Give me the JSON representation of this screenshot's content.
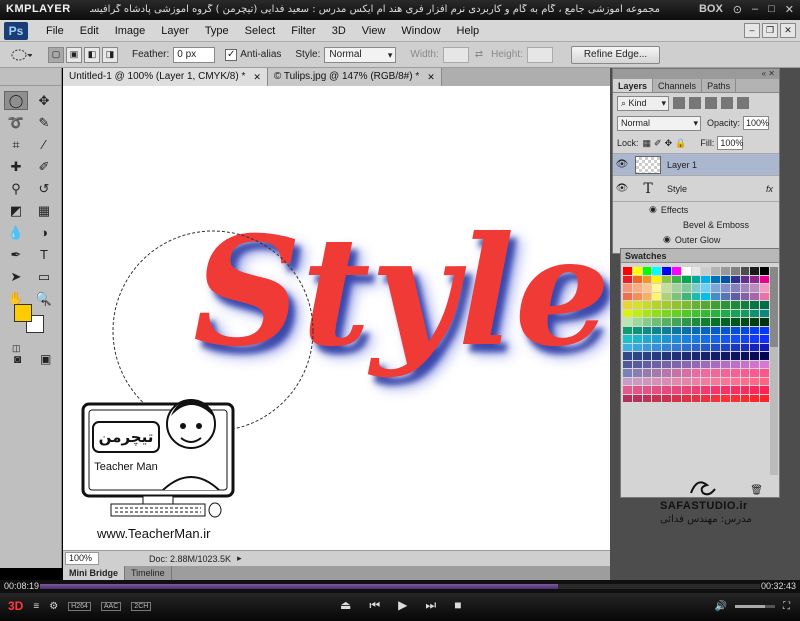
{
  "player": {
    "name": "KMPLAYER",
    "caption": "مجموعه آموزشی جامع ، گام به گام و کاربردی نرم افزار فری هند ام ایکس  مدرس : سعید فدایی (تیچرمن ) گروه آموزشی پادشاه گرافیست ها",
    "box_label": "BOX",
    "time_current": "00:08:19",
    "time_total": "00:32:43",
    "progress": 0.72,
    "badges": [
      "H264",
      "AAC",
      "2CH"
    ],
    "logo_3d": "3D"
  },
  "ps": {
    "logo": "Ps",
    "menu": [
      "File",
      "Edit",
      "Image",
      "Layer",
      "Type",
      "Select",
      "Filter",
      "3D",
      "View",
      "Window",
      "Help"
    ]
  },
  "options": {
    "feather_label": "Feather:",
    "feather_value": "0 px",
    "antialias_label": "Anti-alias",
    "style_label": "Style:",
    "style_value": "Normal",
    "width_label": "Width:",
    "height_label": "Height:",
    "refine_label": "Refine Edge..."
  },
  "tabs": [
    {
      "label": "Untitled-1 @ 100% (Layer 1, CMYK/8) *"
    },
    {
      "label": "© Tulips.jpg @ 147% (RGB/8#) *"
    }
  ],
  "canvas": {
    "art_text": "Style",
    "teacher_logo": "تیچرمن",
    "teacher_name": "Teacher Man",
    "teacher_url": "www.TeacherMan.ir"
  },
  "status": {
    "zoom": "100%",
    "doc": "Doc: 2.88M/1023.5K"
  },
  "bottom_tabs": [
    "Mini Bridge",
    "Timeline"
  ],
  "layers": {
    "tabs": [
      "Layers",
      "Channels",
      "Paths"
    ],
    "kind_label": "Kind",
    "blend": "Normal",
    "opacity_label": "Opacity:",
    "opacity": "100%",
    "lock_label": "Lock:",
    "fill_label": "Fill:",
    "fill": "100%",
    "layer1": "Layer 1",
    "style_layer": "Style",
    "fx": "fx",
    "effects": "Effects",
    "bevel": "Bevel & Emboss",
    "outer_glow": "Outer Glow"
  },
  "swatches": {
    "title": "Swatches",
    "colors": [
      "#ff0000",
      "#ffff00",
      "#00ff00",
      "#00ffff",
      "#0000ff",
      "#ff00ff",
      "#ffffff",
      "#e6e6e6",
      "#cccccc",
      "#b3b3b3",
      "#999999",
      "#808080",
      "#4d4d4d",
      "#1a1a1a",
      "#000000",
      "#ed1c24",
      "#f26522",
      "#f7941d",
      "#fff200",
      "#8dc63f",
      "#39b54a",
      "#00a651",
      "#00a99d",
      "#00aeef",
      "#0072bc",
      "#0054a6",
      "#2e3192",
      "#662d91",
      "#92278f",
      "#ec008c",
      "#f69679",
      "#f9ad81",
      "#fdc689",
      "#fff799",
      "#c4df9b",
      "#a3d39c",
      "#82ca9c",
      "#7accc8",
      "#6dcff6",
      "#7da7d9",
      "#8393ca",
      "#8781bd",
      "#a186be",
      "#bd8cbf",
      "#f49ac2",
      "#f26c4f",
      "#f68e56",
      "#fbaf5d",
      "#fff568",
      "#acd373",
      "#7cc576",
      "#3bb878",
      "#1abbb4",
      "#00bff3",
      "#448ccb",
      "#5674b9",
      "#605ca8",
      "#855fa8",
      "#a864a8",
      "#f06eaa",
      "#e8d531",
      "#d7e02b",
      "#c8dc24",
      "#b6d427",
      "#a3cc2a",
      "#8fc42d",
      "#7cbc2f",
      "#67b231",
      "#55a834",
      "#3f9e36",
      "#2b9438",
      "#1c8a3a",
      "#108040",
      "#067646",
      "#006c4c",
      "#d9f210",
      "#c0ed12",
      "#a6e614",
      "#8fdf17",
      "#78d81b",
      "#62d11f",
      "#4fca24",
      "#3ec32a",
      "#30bb33",
      "#26b33e",
      "#1eab4b",
      "#18a258",
      "#139a65",
      "#0f9172",
      "#0c887e",
      "#b8e6b0",
      "#9ed99b",
      "#85cc87",
      "#6cbf75",
      "#55b264",
      "#40a555",
      "#2d9847",
      "#1d8b3b",
      "#117e31",
      "#087128",
      "#036421",
      "#00571b",
      "#004a16",
      "#003e12",
      "#00320e",
      "#0e9b6e",
      "#0d9478",
      "#0c8d82",
      "#0b868c",
      "#0a7f96",
      "#0978a0",
      "#0871aa",
      "#076ab4",
      "#0663be",
      "#055cc8",
      "#0455d2",
      "#034edc",
      "#0247e6",
      "#0140f0",
      "#0039fa",
      "#1ec0c8",
      "#1db6cc",
      "#1cabd0",
      "#1ba1d4",
      "#1a96d8",
      "#198cdc",
      "#1881e0",
      "#1777e4",
      "#166ce8",
      "#1562ec",
      "#1457f0",
      "#134df4",
      "#1242f8",
      "#1138fc",
      "#102dff",
      "#3db1e3",
      "#3aa6e0",
      "#379bdd",
      "#3490da",
      "#3185d7",
      "#2e7ad4",
      "#2b6fd1",
      "#2864ce",
      "#2559cb",
      "#224ec8",
      "#1f43c5",
      "#1c38c2",
      "#192dbf",
      "#1622bc",
      "#1317b9",
      "#2f4a8c",
      "#2c4588",
      "#294084",
      "#263b80",
      "#23367c",
      "#203178",
      "#1d2c74",
      "#1a2770",
      "#17226c",
      "#141d68",
      "#111864",
      "#0e1360",
      "#0b0e5c",
      "#080958",
      "#050454",
      "#4e5a9a",
      "#585c9e",
      "#625ea2",
      "#6c60a6",
      "#7662aa",
      "#8064ae",
      "#8a66b2",
      "#9468b6",
      "#9e6aba",
      "#a86cbe",
      "#b26ec2",
      "#bc70c6",
      "#c672ca",
      "#d074ce",
      "#da76d2",
      "#7a7fb8",
      "#8a7cb5",
      "#9a79b2",
      "#aa76af",
      "#ba73ac",
      "#ca70a9",
      "#da6da6",
      "#ea6aa3",
      "#f267a0",
      "#f4649d",
      "#f6619a",
      "#f85e97",
      "#fa5b94",
      "#fc5891",
      "#fe558e",
      "#c79cc9",
      "#cc98c4",
      "#d194bf",
      "#d690ba",
      "#db8cb5",
      "#e088b0",
      "#e584ab",
      "#ea80a6",
      "#ef7ca1",
      "#f4789c",
      "#f97497",
      "#fe7092",
      "#ff6c8d",
      "#ff6888",
      "#ff6483",
      "#e05a90",
      "#e2568c",
      "#e45288",
      "#e64e84",
      "#e84a80",
      "#ea467c",
      "#ec4278",
      "#ee3e74",
      "#f03a70",
      "#f2366c",
      "#f43268",
      "#f62e64",
      "#f82a60",
      "#fa265c",
      "#fc2258",
      "#b03060",
      "#b8305c",
      "#c03058",
      "#c83054",
      "#d03050",
      "#d8304c",
      "#e03048",
      "#e83044",
      "#f03040",
      "#f8303c",
      "#ff3038",
      "#ff2c34",
      "#ff2830",
      "#ff242c",
      "#ff2028"
    ]
  },
  "credits": {
    "studio": "SAFASTUDIO.ir",
    "teacher": "مدرس: مهندس فدائی"
  }
}
